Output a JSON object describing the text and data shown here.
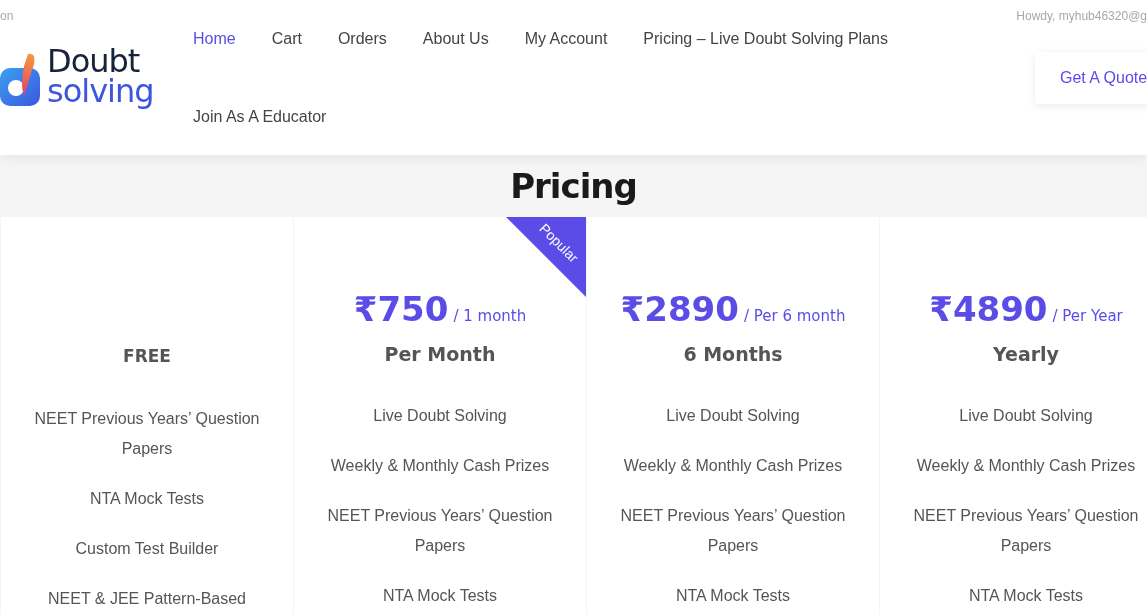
{
  "top_bar": {
    "left_text": "on",
    "greeting": "Howdy, myhub46320@g"
  },
  "logo": {
    "line_1": "Doubt",
    "line_2": "solving"
  },
  "nav": [
    {
      "label": "Home",
      "selected": true
    },
    {
      "label": "Cart",
      "selected": false
    },
    {
      "label": "Orders",
      "selected": false
    },
    {
      "label": "About Us",
      "selected": false
    },
    {
      "label": "My Account",
      "selected": false
    },
    {
      "label": "Pricing – Live Doubt Solving Plans",
      "selected": false
    },
    {
      "label": "Join As A Educator",
      "selected": false
    }
  ],
  "quote_button": "Get A Quote",
  "title": "Pricing",
  "plans": [
    {
      "kind": "free",
      "name": "FREE",
      "popular": false,
      "features": [
        "NEET Previous Years’ Question Papers",
        "NTA Mock Tests",
        "Custom Test Builder",
        "NEET & JEE Pattern-Based"
      ]
    },
    {
      "kind": "paid",
      "price": "₹750",
      "period": "/ 1 month",
      "name": "Per Month",
      "popular": true,
      "badge": "Popular",
      "features": [
        "Live Doubt Solving",
        "Weekly & Monthly Cash Prizes",
        "NEET Previous Years’ Question Papers",
        "NTA Mock Tests"
      ]
    },
    {
      "kind": "paid",
      "price": "₹2890",
      "period": "/ Per 6 month",
      "name": "6 Months",
      "popular": false,
      "features": [
        "Live Doubt Solving",
        "Weekly & Monthly Cash Prizes",
        "NEET Previous Years’ Question Papers",
        "NTA Mock Tests"
      ]
    },
    {
      "kind": "paid",
      "price": "₹4890",
      "period": "/ Per Year",
      "name": "Yearly",
      "popular": false,
      "features": [
        "Live Doubt Solving",
        "Weekly & Monthly Cash Prizes",
        "NEET Previous Years’ Question Papers",
        "NTA Mock Tests"
      ]
    }
  ]
}
